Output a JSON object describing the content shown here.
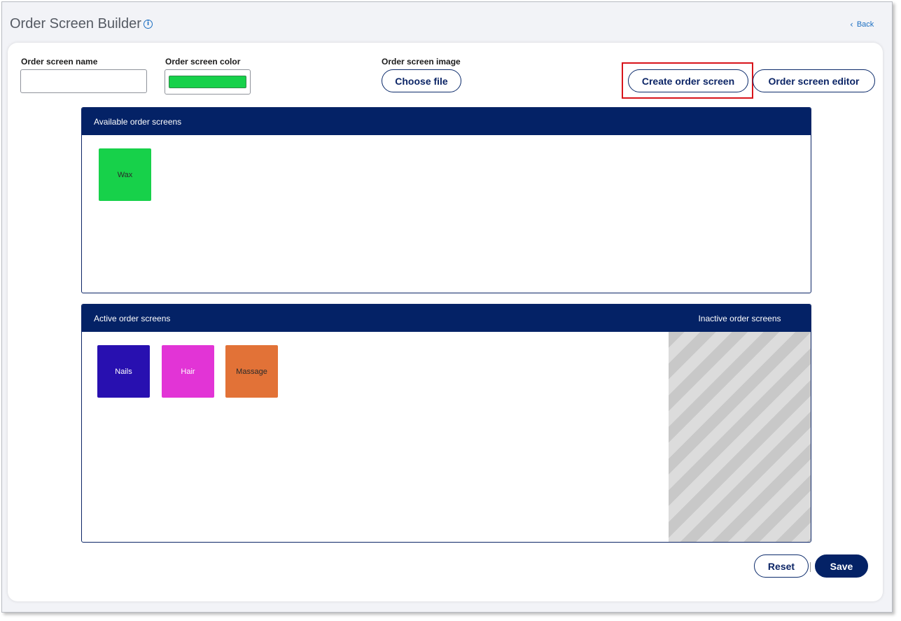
{
  "header": {
    "title": "Order Screen Builder",
    "info_icon": "info-icon",
    "back_label": "Back",
    "back_icon": "chevron-left-icon"
  },
  "form": {
    "name_label": "Order screen name",
    "name_value": "",
    "color_label": "Order screen color",
    "color_value": "#17d14a",
    "image_label": "Order screen image",
    "choose_file_label": "Choose file",
    "create_label": "Create order screen",
    "editor_label": "Order screen editor"
  },
  "available": {
    "title": "Available order screens",
    "tiles": [
      {
        "label": "Wax",
        "color": "#17d14a",
        "text_color": "#2a2a2a"
      }
    ]
  },
  "active": {
    "title": "Active order screens",
    "inactive_title": "Inactive order screens",
    "tiles": [
      {
        "label": "Nails",
        "color": "#2810b0",
        "text_color": "#ffffff"
      },
      {
        "label": "Hair",
        "color": "#e234d6",
        "text_color": "#ffffff"
      },
      {
        "label": "Massage",
        "color": "#e27237",
        "text_color": "#2a2a2a"
      }
    ]
  },
  "footer": {
    "reset_label": "Reset",
    "save_label": "Save"
  },
  "colors": {
    "navy": "#042266",
    "accent_link": "#1d6fc2",
    "highlight": "#d8141b"
  }
}
